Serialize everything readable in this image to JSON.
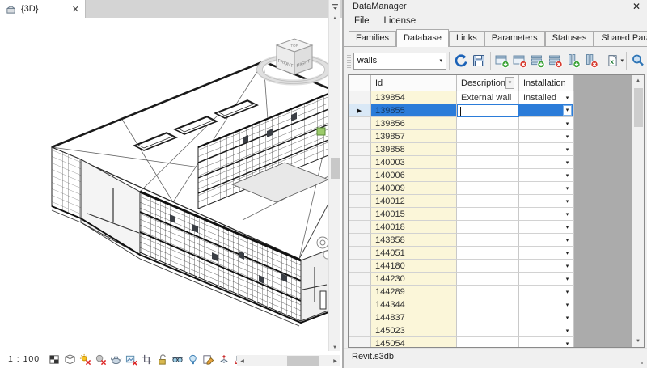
{
  "left_pane": {
    "tab": {
      "label": "{3D}",
      "close_glyph": "✕",
      "icon": "3d-view-icon"
    },
    "viewcube": {
      "top": "TOP",
      "front": "FRONT",
      "right": "RIGHT"
    },
    "view_control_bar": {
      "scale_label": "1 : 100",
      "icons": [
        "detail-level",
        "visual-style",
        "sun-path-off",
        "shadows-off",
        "rendering-dialog",
        "crop-view-off",
        "crop-region",
        "unlocked-orientation",
        "temporary-hide-isolate",
        "reveal-hidden-elements",
        "temporary-view-properties",
        "displacement-sets",
        "reveal-constraints"
      ]
    },
    "scrollbar_glyphs": {
      "up": "▲",
      "down": "▼",
      "left": "◀",
      "right": "▶"
    }
  },
  "panel": {
    "title": "DataManager",
    "close_glyph": "✕",
    "menu": [
      "File",
      "License"
    ],
    "tabs": [
      "Families",
      "Database",
      "Links",
      "Parameters",
      "Statuses",
      "Shared Parameters"
    ],
    "active_tab": "Database",
    "toolbar": {
      "table_selector_value": "walls",
      "dropdown_glyph": "▾",
      "buttons": [
        "refresh",
        "save",
        "add-table",
        "delete-table",
        "add-row",
        "delete-row",
        "add-column",
        "delete-column",
        "export",
        "preview"
      ]
    },
    "grid": {
      "columns": [
        "Id",
        "Description",
        "Installation"
      ],
      "selected_id": "139855",
      "rows": [
        {
          "id": "139854",
          "description": "External wall",
          "installation": "Installed"
        },
        {
          "id": "139855",
          "description": "",
          "installation": ""
        },
        {
          "id": "139856",
          "description": "",
          "installation": ""
        },
        {
          "id": "139857",
          "description": "",
          "installation": ""
        },
        {
          "id": "139858",
          "description": "",
          "installation": ""
        },
        {
          "id": "140003",
          "description": "",
          "installation": ""
        },
        {
          "id": "140006",
          "description": "",
          "installation": ""
        },
        {
          "id": "140009",
          "description": "",
          "installation": ""
        },
        {
          "id": "140012",
          "description": "",
          "installation": ""
        },
        {
          "id": "140015",
          "description": "",
          "installation": ""
        },
        {
          "id": "140018",
          "description": "",
          "installation": ""
        },
        {
          "id": "143858",
          "description": "",
          "installation": ""
        },
        {
          "id": "144051",
          "description": "",
          "installation": ""
        },
        {
          "id": "144180",
          "description": "",
          "installation": ""
        },
        {
          "id": "144230",
          "description": "",
          "installation": ""
        },
        {
          "id": "144289",
          "description": "",
          "installation": ""
        },
        {
          "id": "144344",
          "description": "",
          "installation": ""
        },
        {
          "id": "144837",
          "description": "",
          "installation": ""
        },
        {
          "id": "145023",
          "description": "",
          "installation": ""
        },
        {
          "id": "145054",
          "description": "",
          "installation": ""
        }
      ]
    },
    "status": "Revit.s3db"
  },
  "colors": {
    "selection_blue": "#2B7CD9",
    "id_cell_cream": "#FBF6D9",
    "empty_area_gray": "#ABABAB",
    "badge_green": "#36A132",
    "badge_red": "#D63B2F",
    "accent_blue": "#1B62B7"
  }
}
